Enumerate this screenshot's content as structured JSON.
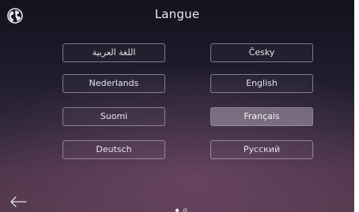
{
  "header": {
    "title": "Langue",
    "globe_icon": "globe-icon"
  },
  "languages": [
    {
      "label": "اللغة العربية",
      "selected": false
    },
    {
      "label": "Česky",
      "selected": false
    },
    {
      "label": "Nederlands",
      "selected": false
    },
    {
      "label": "English",
      "selected": false
    },
    {
      "label": "Suomi",
      "selected": false
    },
    {
      "label": "Français",
      "selected": true
    },
    {
      "label": "Deutsch",
      "selected": false
    },
    {
      "label": "Русский",
      "selected": false
    }
  ],
  "footer": {
    "back_icon": "arrow-left-icon",
    "page_indicator": {
      "current": 1,
      "total": 2
    }
  },
  "colors": {
    "background_top": "#12121d",
    "background_bottom": "#523749",
    "selected_button": "#9a8fa0"
  }
}
